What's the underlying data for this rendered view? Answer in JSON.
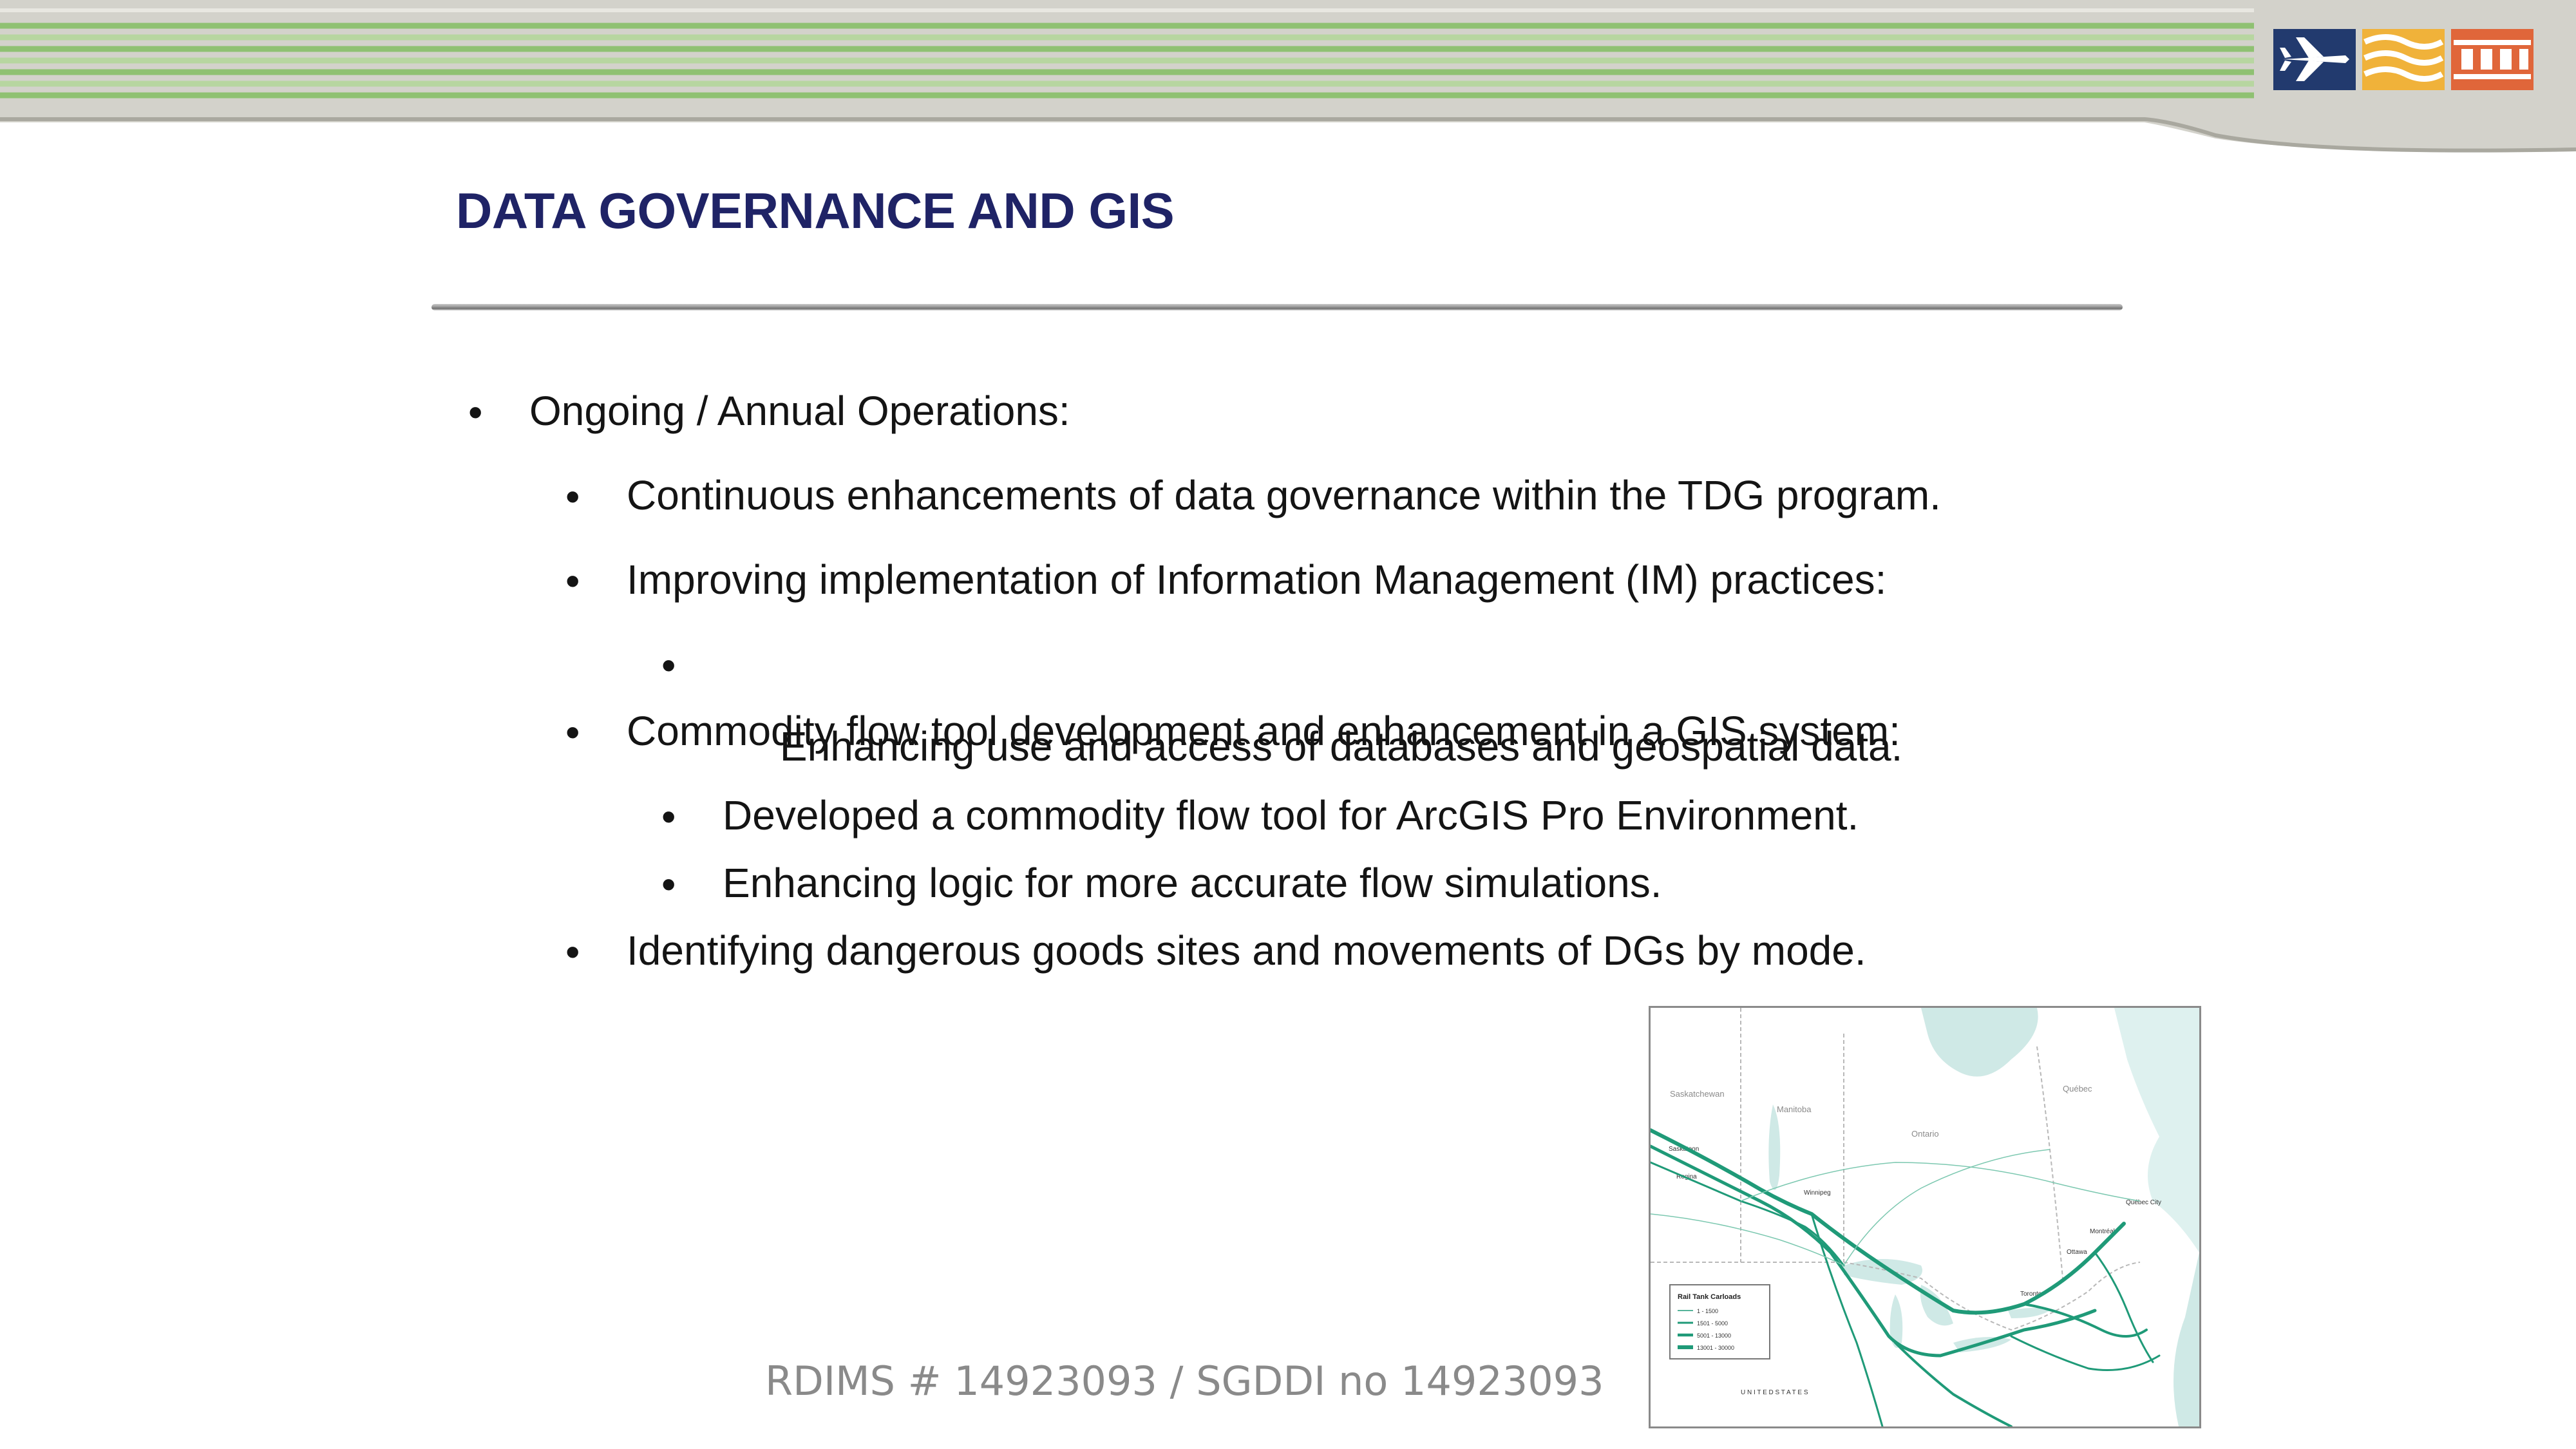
{
  "slide": {
    "title": "DATA GOVERNANCE AND GIS",
    "bullets": [
      {
        "level": 1,
        "text": "Ongoing / Annual Operations:"
      },
      {
        "level": 2,
        "text": "Continuous enhancements of data governance within the TDG program."
      },
      {
        "level": 2,
        "text": "Improving implementation of Information Management (IM) practices:"
      },
      {
        "level": 3,
        "text": " Enhancing use and access of databases and geospatial data."
      },
      {
        "level": 2,
        "text": "Commodity flow tool development and enhancement in a GIS system:"
      },
      {
        "level": 3,
        "text": "Developed a commodity flow tool for ArcGIS Pro Environment."
      },
      {
        "level": 3,
        "text": "Enhancing logic for more accurate flow simulations."
      },
      {
        "level": 2,
        "text": "Identifying dangerous goods sites and movements of DGs by mode."
      }
    ],
    "bullet_glyph": "•",
    "footer_reference": "RDIMS # 14923093 / SGDDI no 14923093"
  },
  "map": {
    "labels": {
      "saskatchewan": "Saskatchewan",
      "manitoba": "Manitoba",
      "ontario": "Ontario",
      "quebec": "Québec",
      "saskatoon": "Saskatoon",
      "regina": "Regina",
      "winnipeg": "Winnipeg",
      "quebec_city": "Québec City",
      "montreal": "Montréal",
      "ottawa": "Ottawa",
      "toronto": "Toronto",
      "united_states": "U N I T E D   S T A T E S"
    },
    "legend": {
      "title": "Rail Tank Carloads",
      "items": [
        "1 - 1500",
        "1501 - 5000",
        "5001 - 13000",
        "13001 - 30000"
      ]
    },
    "colors": {
      "water": "#cfe9e6",
      "land": "#ffffff",
      "flow": "#1f9a78"
    }
  },
  "colors": {
    "title": "#1f2366",
    "header_green": "#8ec071",
    "header_grey": "#c8c7bf",
    "logo_blue": "#223a6e",
    "logo_yellow": "#f0b23a",
    "logo_orange": "#e0663a"
  },
  "icons": [
    "airplane-logo-icon",
    "marine-waves-logo-icon",
    "rail-track-logo-icon"
  ]
}
